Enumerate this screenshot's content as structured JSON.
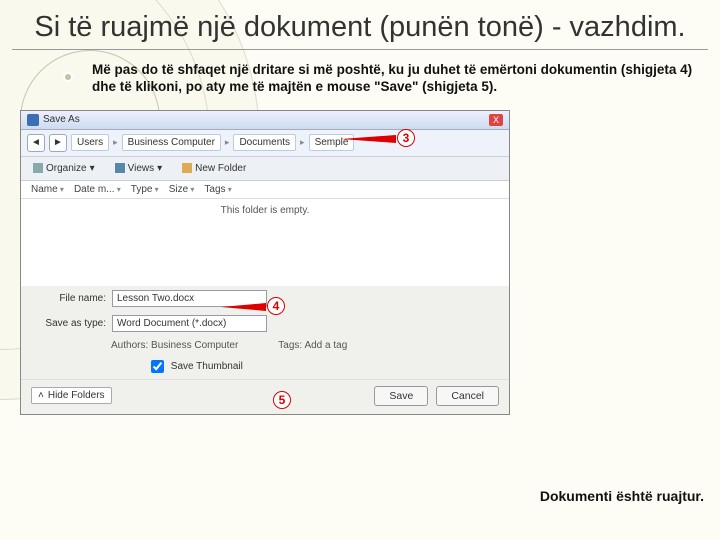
{
  "slide": {
    "title": "Si të ruajmë një dokument (punën tonë) - vazhdim.",
    "intro": "Më pas do të shfaqet një dritare si më poshtë, ku ju duhet të emërtoni dokumentin (shigjeta 4) dhe të klikoni, po aty me të majtën e mouse \"Save\" (shigjeta 5).",
    "footer": "Dokumenti është ruajtur."
  },
  "dialog": {
    "title": "Save As",
    "close": "X",
    "nav": {
      "back": "◄",
      "fwd": "►"
    },
    "breadcrumbs": [
      "Users",
      "Business Computer",
      "Documents",
      "Semple"
    ],
    "toolbar": {
      "organize": "Organize",
      "views": "Views",
      "newfolder": "New Folder"
    },
    "columns": [
      "Name",
      "Date m...",
      "Type",
      "Size",
      "Tags"
    ],
    "empty": "This folder is empty.",
    "filename_label": "File name:",
    "filename_value": "Lesson Two.docx",
    "savetype_label": "Save as type:",
    "savetype_value": "Word Document (*.docx)",
    "authors_label": "Authors:",
    "authors_value": "Business Computer",
    "tags_label": "Tags:",
    "tags_value": "Add a tag",
    "thumbnail": "Save Thumbnail",
    "hide": "Hide Folders",
    "save": "Save",
    "cancel": "Cancel"
  },
  "callouts": {
    "c3": "3",
    "c4": "4",
    "c5": "5"
  }
}
